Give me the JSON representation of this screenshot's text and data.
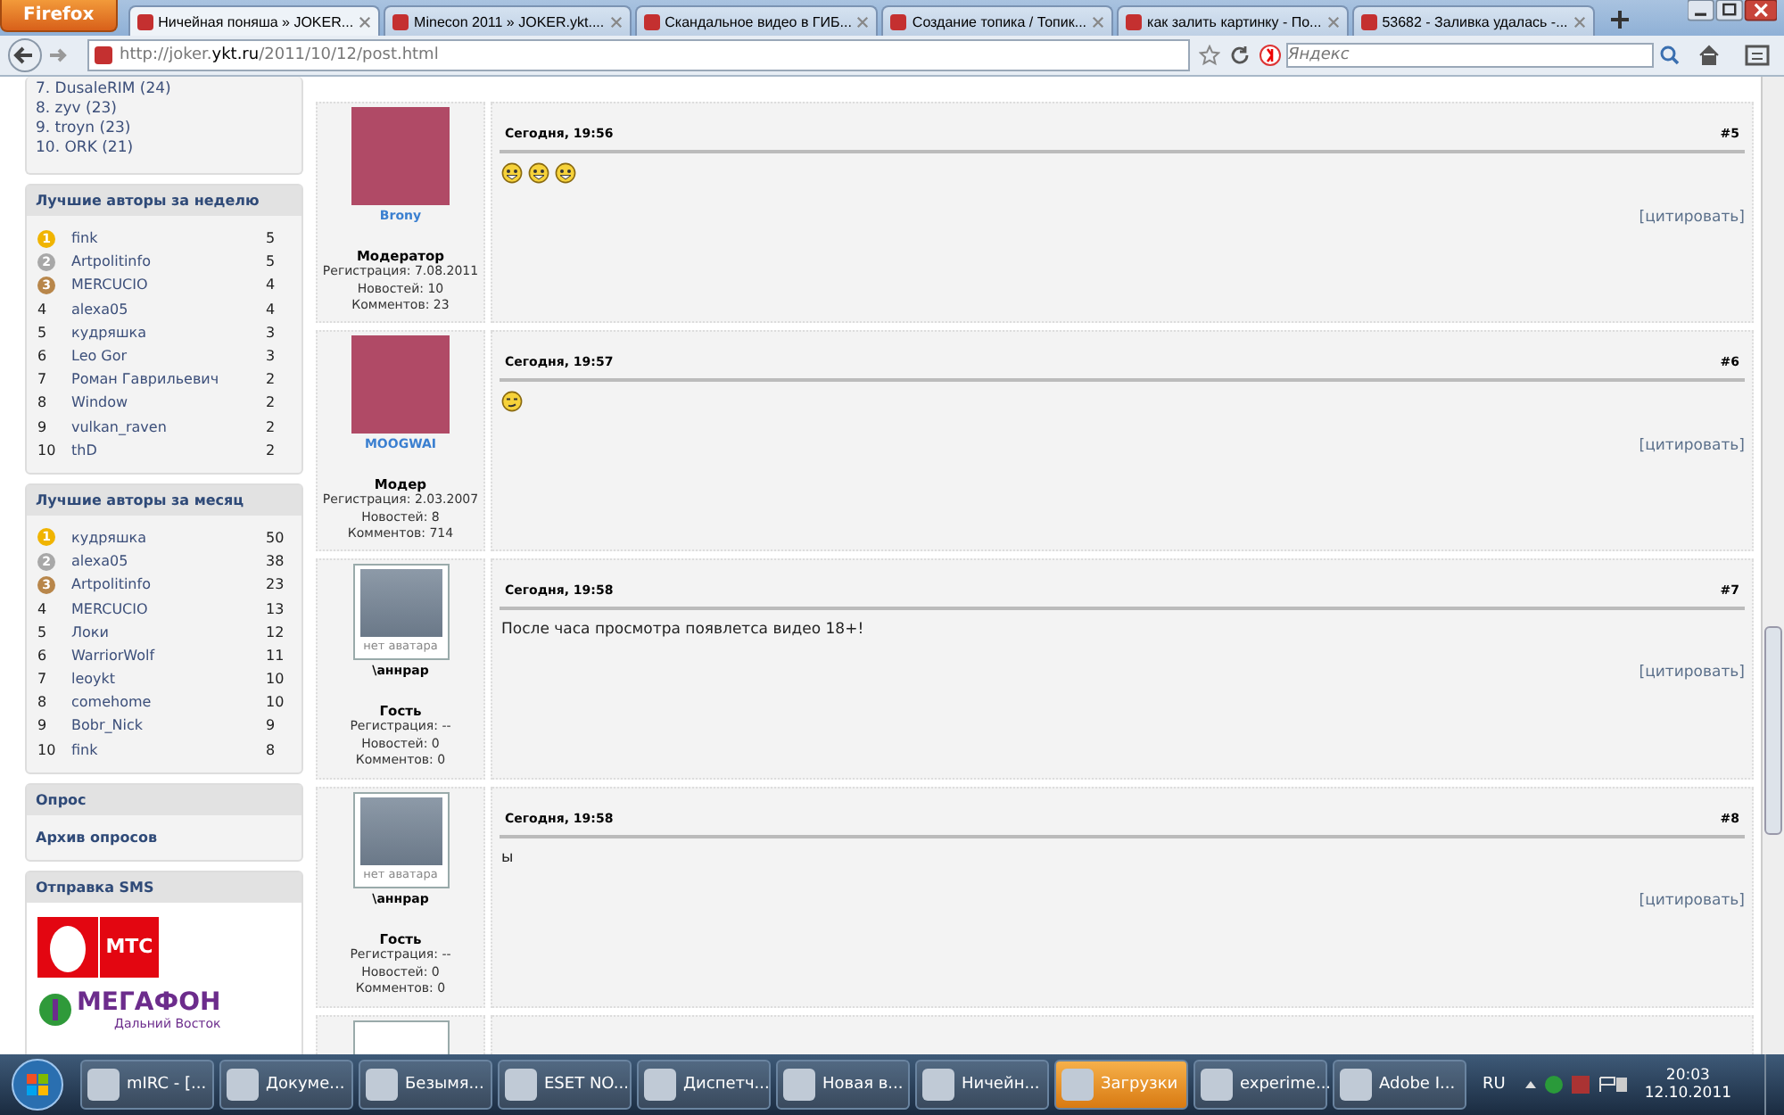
{
  "browser": {
    "menu_button": "Firefox",
    "tabs": [
      {
        "label": "Ничейная поняша » JOKER...",
        "selected": true
      },
      {
        "label": "Minecon 2011 » JOKER.ykt....",
        "selected": false
      },
      {
        "label": "Скандальное видео в ГИБ...",
        "selected": false
      },
      {
        "label": "Создание топика / Топик...",
        "selected": false
      },
      {
        "label": "как залить картинку - По...",
        "selected": false
      },
      {
        "label": "53682 - Заливка удалась -...",
        "selected": false
      }
    ],
    "url": "http://joker.**ykt.ru**/2011/10/12/post.html",
    "search_placeholder": "Яндекс"
  },
  "sidebar": {
    "top_list": [
      "7. DusaleRIM (24)",
      "8. zyv (23)",
      "9. troyn (23)",
      "10. ORK (21)"
    ],
    "blocks": [
      {
        "title": "Лучшие авторы за неделю",
        "kind": "ranking",
        "rows": [
          {
            "rank": "1",
            "name": "fink",
            "count": "5",
            "color": "#f0b400"
          },
          {
            "rank": "2",
            "name": "Artpolitinfo",
            "count": "5",
            "color": "#a8a8a8"
          },
          {
            "rank": "3",
            "name": "MERCUCIO",
            "count": "4",
            "color": "#b8864a"
          },
          {
            "rank": "4",
            "name": "alexa05",
            "count": "4"
          },
          {
            "rank": "5",
            "name": "кудряшка",
            "count": "3"
          },
          {
            "rank": "6",
            "name": "Leo Gor",
            "count": "3"
          },
          {
            "rank": "7",
            "name": "Роман Гаврильевич",
            "count": "2"
          },
          {
            "rank": "8",
            "name": "Window",
            "count": "2"
          },
          {
            "rank": "9",
            "name": "vulkan_raven",
            "count": "2"
          },
          {
            "rank": "10",
            "name": "thD",
            "count": "2"
          }
        ]
      },
      {
        "title": "Лучшие авторы за месяц",
        "kind": "ranking",
        "rows": [
          {
            "rank": "1",
            "name": "кудряшка",
            "count": "50",
            "color": "#f0b400"
          },
          {
            "rank": "2",
            "name": "alexa05",
            "count": "38",
            "color": "#a8a8a8"
          },
          {
            "rank": "3",
            "name": "Artpolitinfo",
            "count": "23",
            "color": "#b8864a"
          },
          {
            "rank": "4",
            "name": "MERCUCIO",
            "count": "13"
          },
          {
            "rank": "5",
            "name": "Локи",
            "count": "12"
          },
          {
            "rank": "6",
            "name": "WarriorWolf",
            "count": "11"
          },
          {
            "rank": "7",
            "name": "leoykt",
            "count": "10"
          },
          {
            "rank": "8",
            "name": "comehome",
            "count": "10"
          },
          {
            "rank": "9",
            "name": "Bobr_Nick",
            "count": "9"
          },
          {
            "rank": "10",
            "name": "fink",
            "count": "8"
          }
        ]
      },
      {
        "title": "Опрос",
        "kind": "links",
        "links": [
          "Архив опросов"
        ]
      },
      {
        "title": "Отправка SMS",
        "kind": "operators",
        "operators": [
          {
            "kind": "mts",
            "name": "МТС"
          },
          {
            "kind": "megafon",
            "name": "МЕГАФОН",
            "region": "Дальний Восток"
          }
        ]
      }
    ]
  },
  "posts": [
    {
      "time": "Сегодня, 19:56",
      "number": "#5",
      "author": "Brony",
      "author_link": true,
      "avatar": {
        "kind": "photo"
      },
      "role": "Модератор",
      "registration": "Регистрация: 7.08.2011",
      "news": "Новостей: 10",
      "comments": "Комментов: 23",
      "body": {
        "kind": "emoticons",
        "emoticons": [
          {
            "kind": "grin"
          },
          {
            "kind": "grin"
          },
          {
            "kind": "grin"
          }
        ]
      },
      "quote": "[цитировать]"
    },
    {
      "time": "Сегодня, 19:57",
      "number": "#6",
      "author": "MOOGWAI",
      "author_link": true,
      "avatar": {
        "kind": "photo"
      },
      "role": "Модер",
      "registration": "Регистрация: 2.03.2007",
      "news": "Новостей: 8",
      "comments": "Комментов: 714",
      "body": {
        "kind": "emoticons",
        "emoticons": [
          {
            "kind": "wink"
          }
        ]
      },
      "quote": "[цитировать]"
    },
    {
      "time": "Сегодня, 19:58",
      "number": "#7",
      "author": "\\аннрар",
      "author_link": false,
      "avatar": {
        "kind": "none",
        "caption": "нет аватара"
      },
      "role": "Гость",
      "registration": "Регистрация: --",
      "news": "Новостей: 0",
      "comments": "Комментов: 0",
      "body": {
        "kind": "text",
        "text": "После часа просмотра появлетса видео 18+!"
      },
      "quote": "[цитировать]"
    },
    {
      "time": "Сегодня, 19:58",
      "number": "#8",
      "author": "\\аннрар",
      "author_link": false,
      "avatar": {
        "kind": "none",
        "caption": "нет аватара"
      },
      "role": "Гость",
      "registration": "Регистрация: --",
      "news": "Новостей: 0",
      "comments": "Комментов: 0",
      "body": {
        "kind": "text",
        "text": "ы"
      },
      "quote": "[цитировать]"
    }
  ],
  "taskbar": {
    "items": [
      {
        "label": "mIRC - [...",
        "selected": false
      },
      {
        "label": "Докуме...",
        "selected": false
      },
      {
        "label": "Безымя...",
        "selected": false
      },
      {
        "label": "ESET NO...",
        "selected": false
      },
      {
        "label": "Диспетч...",
        "selected": false
      },
      {
        "label": "Новая в...",
        "selected": false
      },
      {
        "label": "Ничейн...",
        "selected": false
      },
      {
        "label": "Загрузки",
        "selected": true
      },
      {
        "label": "experime...",
        "selected": false
      },
      {
        "label": "Adobe I...",
        "selected": false
      }
    ],
    "language": "RU",
    "time": "20:03",
    "date": "12.10.2011"
  }
}
